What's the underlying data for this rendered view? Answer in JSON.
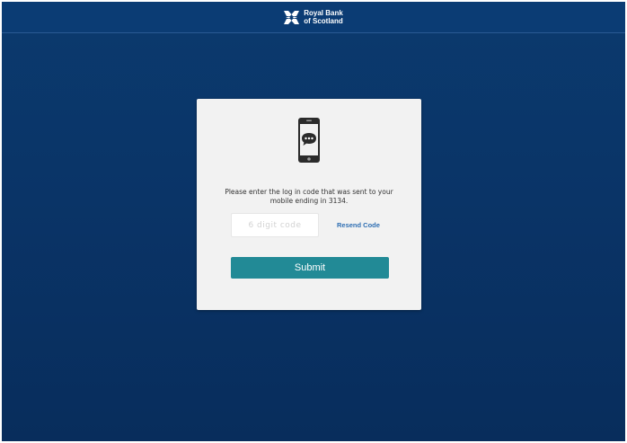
{
  "header": {
    "brand_line1": "Royal Bank",
    "brand_line2": "of Scotland",
    "logo_icon": "rbs-daisy-logo-icon"
  },
  "card": {
    "icon": "phone-message-icon",
    "message": "Please enter the log in code that was sent to your mobile ending in 3134.",
    "code_input": {
      "placeholder": "6 digit code",
      "value": ""
    },
    "resend_label": "Resend Code",
    "submit_label": "Submit"
  },
  "colors": {
    "background": "#0a3467",
    "topbar": "#0b3c74",
    "card": "#f2f2f2",
    "submit": "#228a96",
    "link": "#2f6fb3"
  }
}
